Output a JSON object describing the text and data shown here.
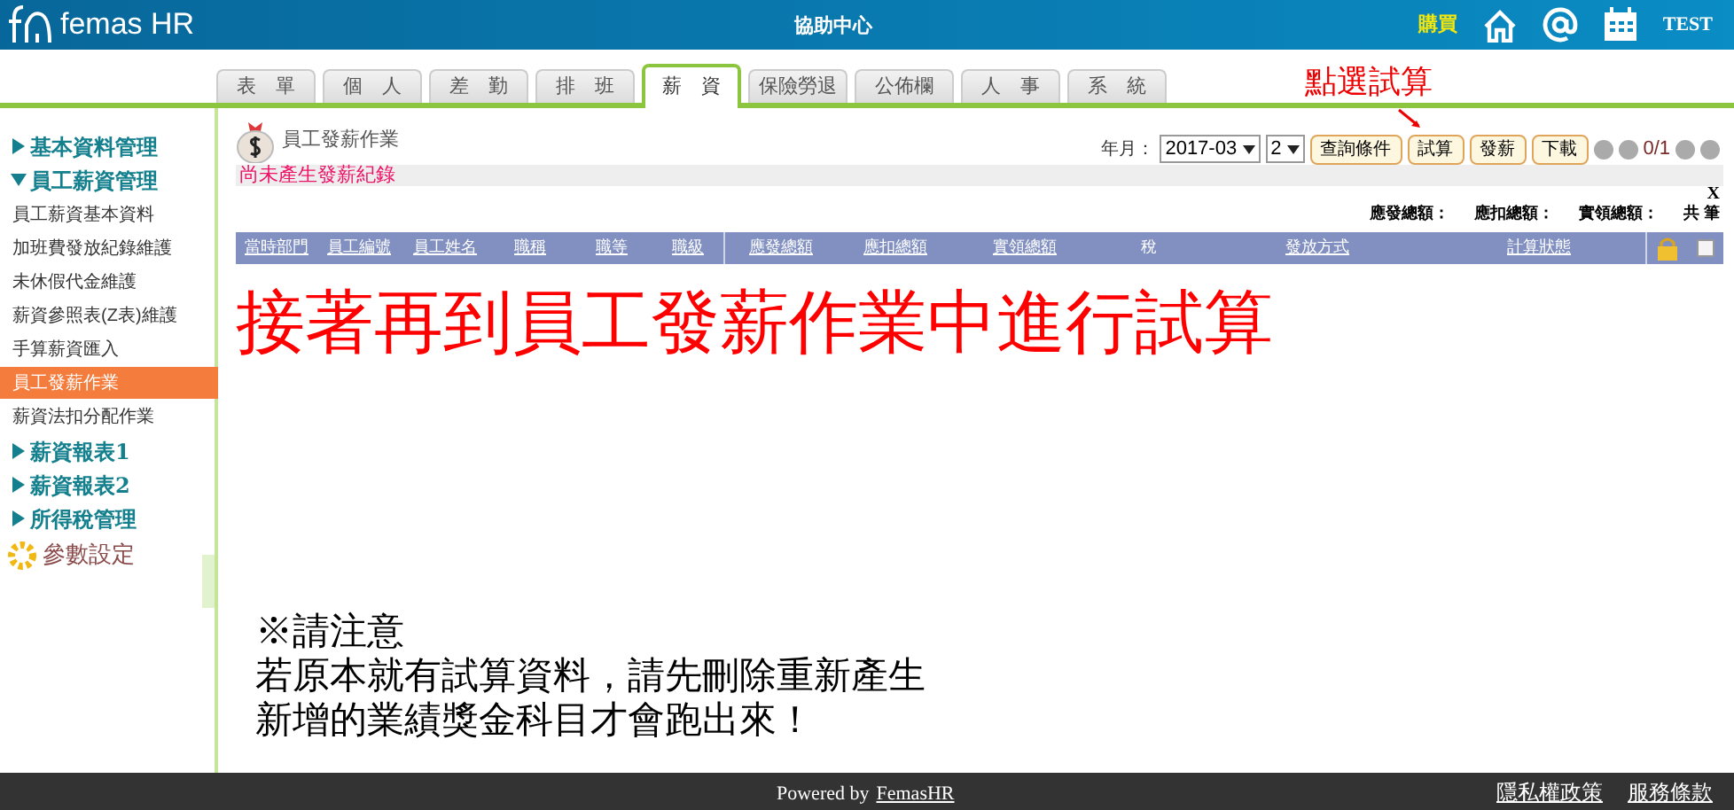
{
  "header": {
    "logo": "femas HR",
    "title": "協助中心",
    "buy_link": "購買",
    "user": "TEST"
  },
  "tabs": [
    {
      "label": "表　單",
      "selected": false
    },
    {
      "label": "個　人",
      "selected": false
    },
    {
      "label": "差　勤",
      "selected": false
    },
    {
      "label": "排　班",
      "selected": false
    },
    {
      "label": "薪　資",
      "selected": true
    },
    {
      "label": "保險勞退",
      "selected": false
    },
    {
      "label": "公佈欄",
      "selected": false
    },
    {
      "label": "人　事",
      "selected": false
    },
    {
      "label": "系　統",
      "selected": false
    }
  ],
  "annotation": {
    "label": "點選試算"
  },
  "sidebar": {
    "items": [
      {
        "label": "基本資料管理",
        "expanded": false
      },
      {
        "label": "員工薪資管理",
        "expanded": true,
        "children": [
          {
            "label": "員工薪資基本資料",
            "selected": false
          },
          {
            "label": "加班費發放紀錄維護",
            "selected": false
          },
          {
            "label": "未休假代金維護",
            "selected": false
          },
          {
            "label": "薪資參照表(Z表)維護",
            "selected": false
          },
          {
            "label": "手算薪資匯入",
            "selected": false
          },
          {
            "label": "員工發薪作業",
            "selected": true
          },
          {
            "label": "薪資法扣分配作業",
            "selected": false
          }
        ]
      },
      {
        "label": "薪資報表1",
        "expanded": false
      },
      {
        "label": "薪資報表2",
        "expanded": false
      },
      {
        "label": "所得稅管理",
        "expanded": false
      }
    ],
    "settings": "參數設定"
  },
  "page": {
    "title": "員工發薪作業",
    "period_label": "年月：",
    "year_month": "2017-03",
    "batch": "2",
    "buttons": [
      "查詢條件",
      "試算",
      "發薪",
      "下載"
    ],
    "pager": "0/1",
    "status": "尚未產生發薪紀錄",
    "close": "X",
    "summary": [
      "應發總額：",
      "應扣總額：",
      "實領總額：",
      "共 筆"
    ]
  },
  "table": {
    "columns": [
      {
        "label": "當時部門",
        "link": true
      },
      {
        "label": "員工編號",
        "link": true
      },
      {
        "label": "員工姓名",
        "link": true
      },
      {
        "label": "職稱",
        "link": true
      },
      {
        "label": "職等",
        "link": true
      },
      {
        "label": "職級",
        "link": true
      },
      {
        "label": "應發總額",
        "link": true
      },
      {
        "label": "應扣總額",
        "link": true
      },
      {
        "label": "實領總額",
        "link": true
      },
      {
        "label": "稅",
        "link": false
      },
      {
        "label": "發放方式",
        "link": true
      },
      {
        "label": "計算狀態",
        "link": true
      }
    ],
    "select_all_checked": false
  },
  "instruction": "接著再到員工發薪作業中進行試算",
  "note": [
    "※請注意",
    "若原本就有試算資料，請先刪除重新產生",
    "新增的業績獎金科目才會跑出來！"
  ],
  "footer": {
    "powered_by": "Powered by",
    "brand_link": "FemasHR",
    "links": [
      "隱私權政策",
      "服務條款"
    ]
  }
}
